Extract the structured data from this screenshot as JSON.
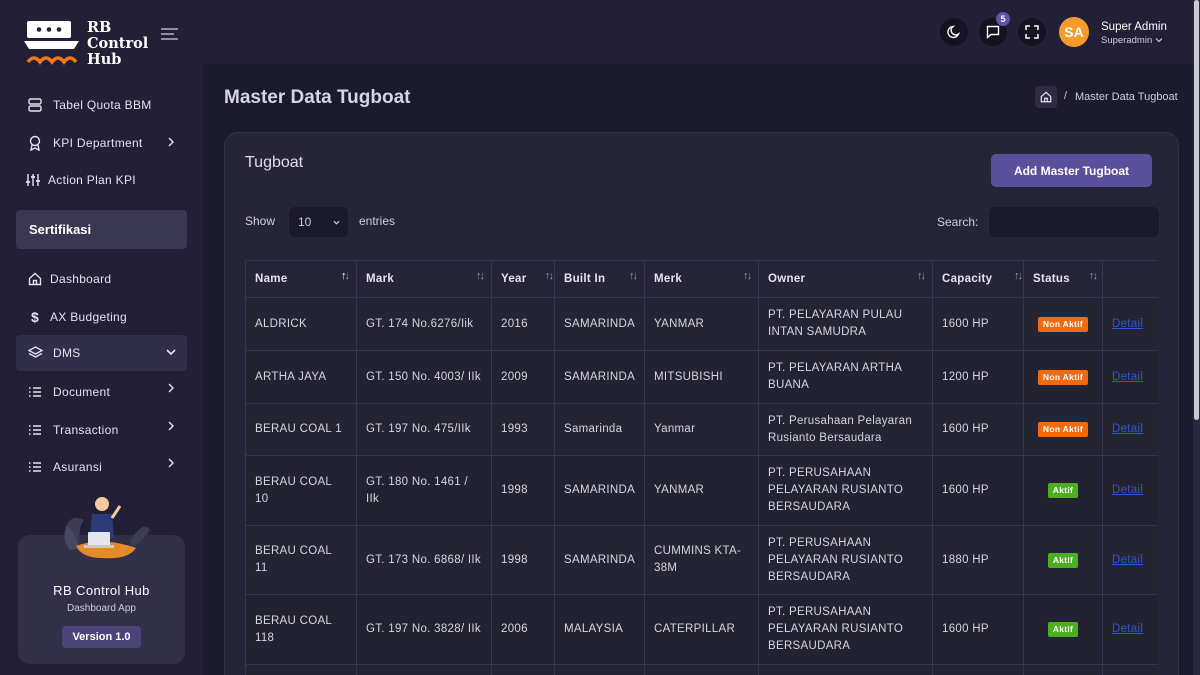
{
  "app": {
    "name_line1": "RB",
    "name_line2": "Control",
    "name_line3": "Hub"
  },
  "sidebar": {
    "items_top": [
      {
        "label": "Tabel Quota BBM",
        "icon": "database-icon"
      },
      {
        "label": "KPI Department",
        "icon": "award-icon",
        "chevron": true
      },
      {
        "label": "Action Plan KPI",
        "icon": "sliders-icon"
      }
    ],
    "section": "Sertifikasi",
    "items_bottom": [
      {
        "label": "Dashboard",
        "icon": "home-icon"
      },
      {
        "label": "AX Budgeting",
        "icon": "dollar-icon"
      },
      {
        "label": "DMS",
        "icon": "layers-icon",
        "chevron": true,
        "active": true
      },
      {
        "label": "Document",
        "icon": "list-icon",
        "chevron": true
      },
      {
        "label": "Transaction",
        "icon": "list-icon",
        "chevron": true
      },
      {
        "label": "Asuransi",
        "icon": "list-icon",
        "chevron": true
      }
    ],
    "promo": {
      "title": "RB Control Hub",
      "subtitle": "Dashboard App",
      "version": "Version 1.0"
    }
  },
  "topbar": {
    "notification_count": "5",
    "avatar_initials": "SA",
    "user_name": "Super Admin",
    "user_role": "Superadmin"
  },
  "page": {
    "title": "Master Data Tugboat",
    "breadcrumb_current": "Master Data Tugboat"
  },
  "card": {
    "title": "Tugboat",
    "add_button": "Add Master Tugboat",
    "show_label": "Show",
    "entries_value": "10",
    "entries_label": "entries",
    "search_label": "Search:"
  },
  "table": {
    "columns": [
      "Name",
      "Mark",
      "Year",
      "Built In",
      "Merk",
      "Owner",
      "Capacity",
      "Status",
      ""
    ],
    "rows": [
      {
        "name": "ALDRICK",
        "mark": "GT. 174 No.6276/Iik",
        "year": "2016",
        "built_in": "SAMARINDA",
        "merk": "YANMAR",
        "owner": "PT. PELAYARAN PULAU INTAN SAMUDRA",
        "capacity": "1600 HP",
        "status": "Non Aktif",
        "action": "Detail"
      },
      {
        "name": "ARTHA JAYA",
        "mark": "GT. 150 No. 4003/ IIk",
        "year": "2009",
        "built_in": "SAMARINDA",
        "merk": "MITSUBISHI",
        "owner": "PT. PELAYARAN ARTHA BUANA",
        "capacity": "1200 HP",
        "status": "Non Aktif",
        "action": "Detail"
      },
      {
        "name": "BERAU COAL 1",
        "mark": "GT. 197 No. 475/IIk",
        "year": "1993",
        "built_in": "Samarinda",
        "merk": "Yanmar",
        "owner": "PT. Perusahaan Pelayaran Rusianto Bersaudara",
        "capacity": "1600 HP",
        "status": "Non Aktif",
        "action": "Detail"
      },
      {
        "name": "BERAU COAL 10",
        "mark": "GT. 180 No. 1461 / IIk",
        "year": "1998",
        "built_in": "SAMARINDA",
        "merk": "YANMAR",
        "owner": "PT. PERUSAHAAN PELAYARAN RUSIANTO BERSAUDARA",
        "capacity": "1600 HP",
        "status": "Aktif",
        "action": "Detail"
      },
      {
        "name": "BERAU COAL 11",
        "mark": "GT. 173 No. 6868/ IIk",
        "year": "1998",
        "built_in": "SAMARINDA",
        "merk": "CUMMINS KTA-38M",
        "owner": "PT. PERUSAHAAN PELAYARAN RUSIANTO BERSAUDARA",
        "capacity": "1880 HP",
        "status": "Aktif",
        "action": "Detail"
      },
      {
        "name": "BERAU COAL 118",
        "mark": "GT. 197 No. 3828/ IIk",
        "year": "2006",
        "built_in": "MALAYSIA",
        "merk": "CATERPILLAR",
        "owner": "PT. PERUSAHAAN PELAYARAN RUSIANTO BERSAUDARA",
        "capacity": "1600 HP",
        "status": "Aktif",
        "action": "Detail"
      }
    ]
  },
  "colors": {
    "accent": "#5a4f9a",
    "active_status": "#4caf1f",
    "inactive_status": "#f06a11",
    "avatar": "#f59a2d"
  }
}
